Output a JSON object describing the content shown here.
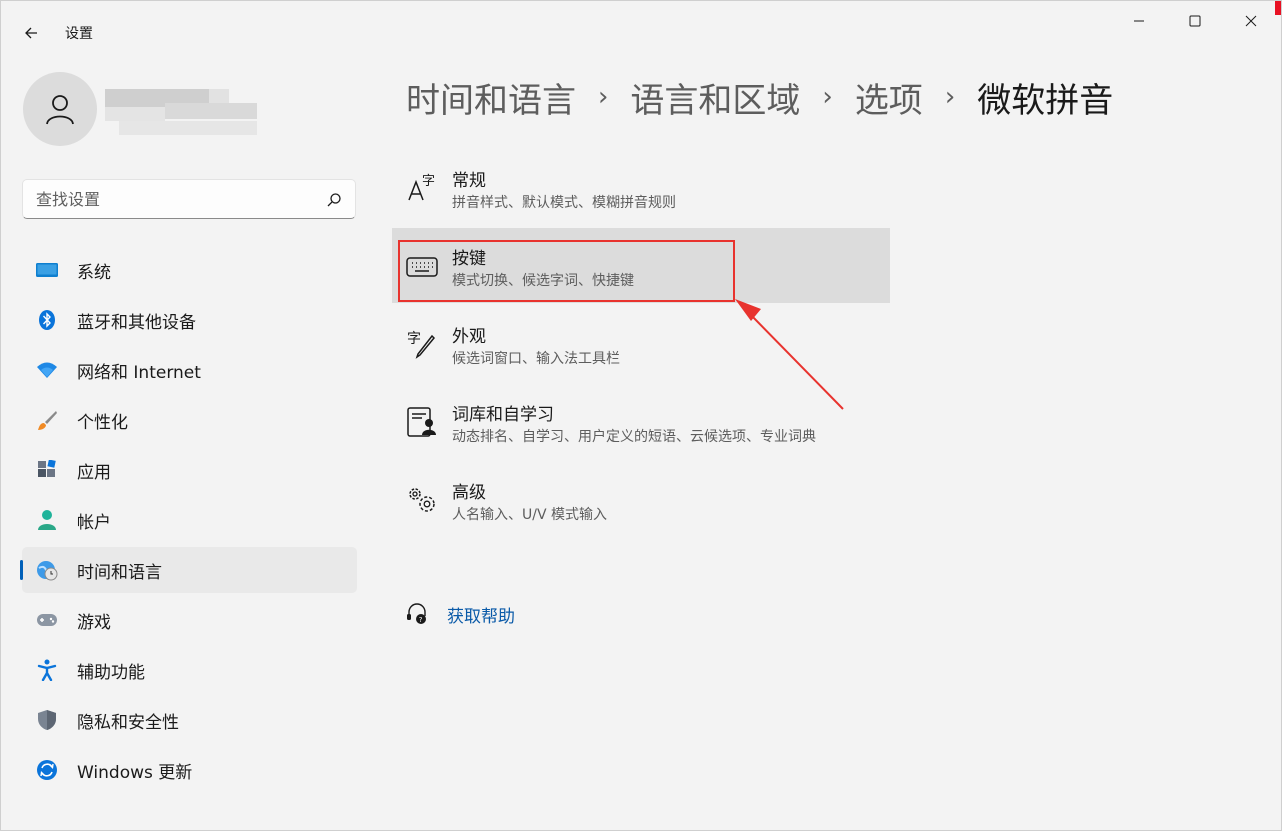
{
  "window": {
    "title": "设置",
    "controls": {
      "minimize": "minimize-icon",
      "maximize": "maximize-icon",
      "close": "close-icon"
    }
  },
  "profile": {
    "avatar_icon": "person-icon"
  },
  "search": {
    "placeholder": "查找设置",
    "icon": "search-icon"
  },
  "sidebar": {
    "items": [
      {
        "label": "系统",
        "icon": "system-icon",
        "active": false
      },
      {
        "label": "蓝牙和其他设备",
        "icon": "bluetooth-icon",
        "active": false
      },
      {
        "label": "网络和 Internet",
        "icon": "wifi-icon",
        "active": false
      },
      {
        "label": "个性化",
        "icon": "brush-icon",
        "active": false
      },
      {
        "label": "应用",
        "icon": "apps-icon",
        "active": false
      },
      {
        "label": "帐户",
        "icon": "account-icon",
        "active": false
      },
      {
        "label": "时间和语言",
        "icon": "time-language-icon",
        "active": true
      },
      {
        "label": "游戏",
        "icon": "gamepad-icon",
        "active": false
      },
      {
        "label": "辅助功能",
        "icon": "accessibility-icon",
        "active": false
      },
      {
        "label": "隐私和安全性",
        "icon": "shield-icon",
        "active": false
      },
      {
        "label": "Windows 更新",
        "icon": "update-icon",
        "active": false
      }
    ]
  },
  "breadcrumb": {
    "items": [
      "时间和语言",
      "语言和区域",
      "选项",
      "微软拼音"
    ],
    "separator": "›"
  },
  "options": [
    {
      "title": "常规",
      "subtitle": "拼音样式、默认模式、模糊拼音规则",
      "icon": "font-char-icon"
    },
    {
      "title": "按键",
      "subtitle": "模式切换、候选字词、快捷键",
      "icon": "keyboard-icon",
      "highlighted": true
    },
    {
      "title": "外观",
      "subtitle": "候选词窗口、输入法工具栏",
      "icon": "char-pen-icon"
    },
    {
      "title": "词库和自学习",
      "subtitle": "动态排名、自学习、用户定义的短语、云候选项、专业词典",
      "icon": "lexicon-icon"
    },
    {
      "title": "高级",
      "subtitle": "人名输入、U/V 模式输入",
      "icon": "gears-icon"
    }
  ],
  "help": {
    "label": "获取帮助",
    "icon": "help-icon"
  },
  "colors": {
    "accent": "#005fb8",
    "annotation": "#e8332e",
    "link": "#0a5aa8"
  }
}
